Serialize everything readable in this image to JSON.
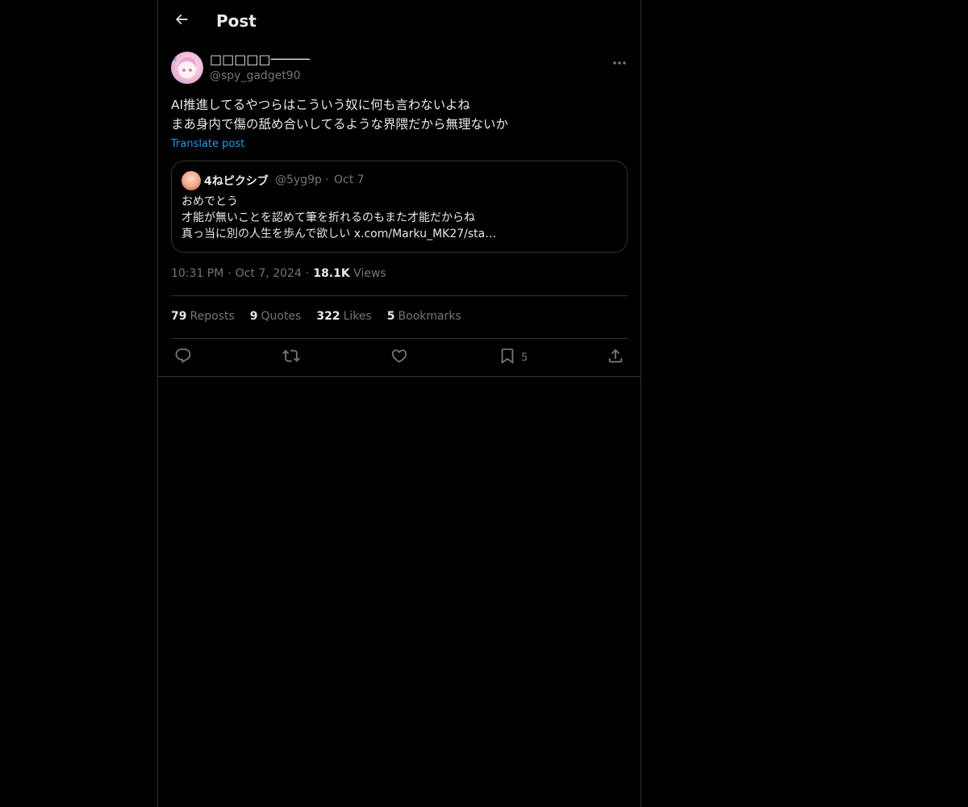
{
  "header": {
    "title": "Post"
  },
  "post": {
    "author_name": "□□□□□─────",
    "author_handle": "@spy_gadget90",
    "text_lines": [
      "AI推進してるやつらはこういう奴に何も言わないよね",
      "まあ身内で傷の舐め合いしてるような界隈だから無理ないか"
    ],
    "translate_label": "Translate post",
    "quote": {
      "author_name": "4ねピクシブ",
      "author_handle": "@5yg9p",
      "separator": "·",
      "date": "Oct 7",
      "text_lines": [
        "おめでとう",
        "才能が無いことを認めて筆を折れるのもまた才能だからね",
        "真っ当に別の人生を歩んで欲しい x.com/Marku_MK27/sta…"
      ]
    },
    "meta": {
      "time": "10:31 PM",
      "date": "Oct 7, 2024",
      "separator": "·",
      "views_count": "18.1K",
      "views_label": "Views"
    },
    "stats": [
      {
        "count": "79",
        "label": "Reposts"
      },
      {
        "count": "9",
        "label": "Quotes"
      },
      {
        "count": "322",
        "label": "Likes"
      },
      {
        "count": "5",
        "label": "Bookmarks"
      }
    ],
    "actions": {
      "reply_icon": "reply-icon",
      "repost_icon": "repost-icon",
      "like_icon": "heart-icon",
      "bookmark_icon": "bookmark-icon",
      "bookmark_count": "5",
      "share_icon": "share-icon"
    }
  },
  "colors": {
    "background": "#000000",
    "border": "#2f3336",
    "text_primary": "#e7e9ea",
    "text_secondary": "#71767b",
    "accent": "#1d9bf0"
  }
}
